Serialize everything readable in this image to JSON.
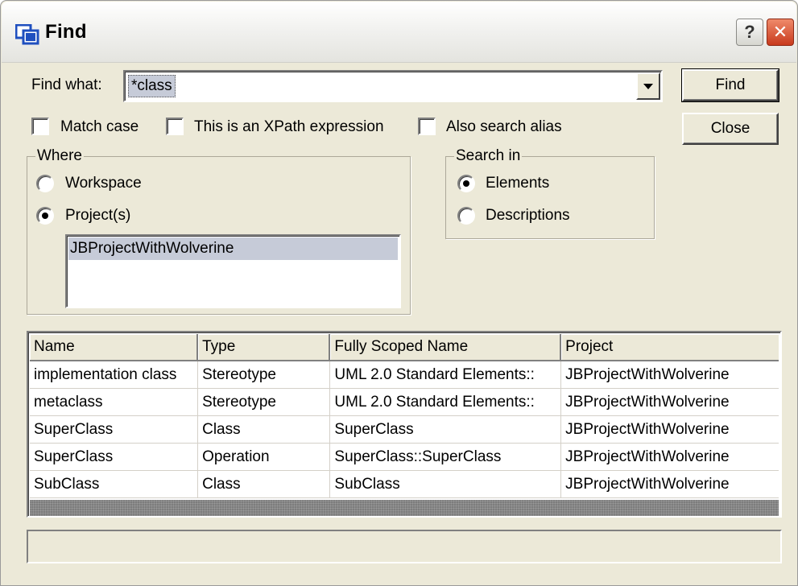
{
  "window": {
    "title": "Find"
  },
  "titlebar": {
    "help_label": "?",
    "close_label": "✕"
  },
  "find": {
    "label": "Find what:",
    "value": "*class",
    "find_button": "Find",
    "close_button": "Close"
  },
  "options": {
    "match_case": {
      "label": "Match case",
      "checked": false
    },
    "xpath": {
      "label": "This is an XPath expression",
      "checked": false
    },
    "alias": {
      "label": "Also search alias",
      "checked": false
    }
  },
  "where": {
    "title": "Where",
    "workspace": "Workspace",
    "projects": "Project(s)",
    "selected": "projects",
    "project_list": [
      "JBProjectWithWolverine"
    ]
  },
  "search_in": {
    "title": "Search in",
    "elements": "Elements",
    "descriptions": "Descriptions",
    "selected": "elements"
  },
  "results": {
    "columns": [
      "Name",
      "Type",
      "Fully Scoped Name",
      "Project"
    ],
    "rows": [
      [
        "implementation class",
        "Stereotype",
        "UML 2.0 Standard Elements::",
        "JBProjectWithWolverine"
      ],
      [
        "metaclass",
        "Stereotype",
        "UML 2.0 Standard Elements::",
        "JBProjectWithWolverine"
      ],
      [
        "SuperClass",
        "Class",
        "SuperClass",
        "JBProjectWithWolverine"
      ],
      [
        "SuperClass",
        "Operation",
        "SuperClass::SuperClass",
        "JBProjectWithWolverine"
      ],
      [
        "SubClass",
        "Class",
        "SubClass",
        "JBProjectWithWolverine"
      ]
    ]
  },
  "status": {
    "text": ""
  }
}
